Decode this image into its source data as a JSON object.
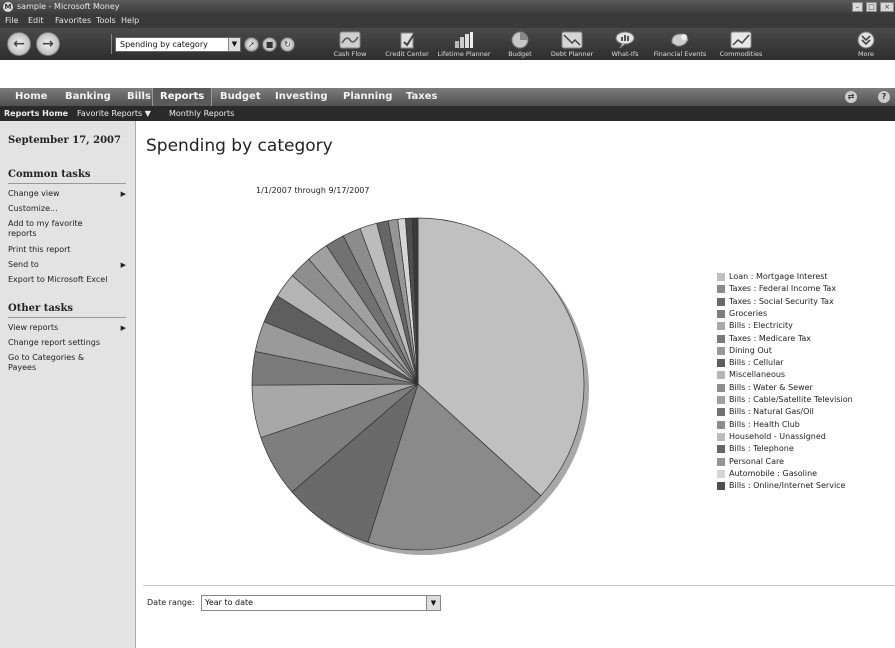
{
  "window": {
    "title": "sample - Microsoft Money",
    "app_icon": "M"
  },
  "menu": [
    "File",
    "Edit",
    "Favorites",
    "Tools",
    "Help"
  ],
  "toolbar": {
    "back_glyph": "←",
    "forward_glyph": "→",
    "report_select": "Spending by category",
    "quick_buttons": [
      "Cash Flow",
      "Credit Center",
      "Lifetime Planner",
      "Budget",
      "Debt Planner",
      "What-Ifs",
      "Financial Events",
      "Commodities",
      "More"
    ]
  },
  "tabs": [
    "Home",
    "Banking",
    "Bills",
    "Reports",
    "Budget",
    "Investing",
    "Planning",
    "Taxes"
  ],
  "selected_tab": "Reports",
  "subnav": {
    "home": "Reports Home",
    "favorites": "Favorite Reports ▼",
    "monthly": "Monthly Reports"
  },
  "sidebar": {
    "date": "September 17, 2007",
    "common_header": "Common tasks",
    "common_items": [
      "Change view",
      "Customize...",
      "Add to my favorite reports",
      "Print this report",
      "Send to",
      "Export to Microsoft Excel"
    ],
    "other_header": "Other tasks",
    "other_items": [
      "View reports",
      "Change report settings",
      "Go to Categories & Payees"
    ]
  },
  "report": {
    "title": "Spending by category",
    "range_text": "1/1/2007 through 9/17/2007",
    "date_range_label": "Date range:",
    "date_range_value": "Year to date"
  },
  "chart_data": {
    "type": "pie",
    "title": "",
    "values": [
      39.5,
      19.5,
      9.5,
      6.5,
      5.5,
      3.5,
      3.2,
      3.0,
      2.6,
      2.4,
      2.3,
      2.0,
      1.9,
      1.8,
      1.2,
      1.0,
      0.8,
      0.7,
      0.6
    ],
    "legend": [
      {
        "label": "Loan : Mortgage Interest",
        "color": "#c0c0c0"
      },
      {
        "label": "Taxes : Federal Income Tax",
        "color": "#8a8a8a"
      },
      {
        "label": "Taxes : Social Security Tax",
        "color": "#6a6a6a"
      },
      {
        "label": "Groceries",
        "color": "#7e7e7e"
      },
      {
        "label": "Bills : Electricity",
        "color": "#a8a8a8"
      },
      {
        "label": "Taxes : Medicare Tax",
        "color": "#7a7a7a"
      },
      {
        "label": "Dining Out",
        "color": "#9a9a9a"
      },
      {
        "label": "Bills : Cellular",
        "color": "#5e5e5e"
      },
      {
        "label": "Miscellaneous",
        "color": "#b4b4b4"
      },
      {
        "label": "Bills : Water & Sewer",
        "color": "#8e8e8e"
      },
      {
        "label": "Bills : Cable/Satellite Television",
        "color": "#a0a0a0"
      },
      {
        "label": "Bills : Natural Gas/Oil",
        "color": "#727272"
      },
      {
        "label": "Bills : Health Club",
        "color": "#8c8c8c"
      },
      {
        "label": "Household - Unassigned",
        "color": "#bcbcbc"
      },
      {
        "label": "Bills : Telephone",
        "color": "#666666"
      },
      {
        "label": "Personal Care",
        "color": "#959595"
      },
      {
        "label": "Automobile : Gasoline",
        "color": "#d6d6d6"
      },
      {
        "label": "Bills : Online/Internet Service",
        "color": "#4e4e4e"
      },
      {
        "label": "",
        "color": "#3a3a3a"
      }
    ]
  }
}
